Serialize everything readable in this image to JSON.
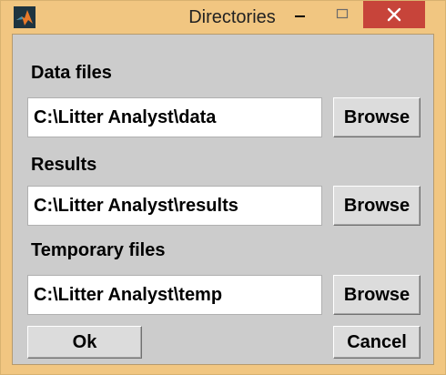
{
  "window": {
    "title": "Directories",
    "app_icon": "matlab-icon",
    "colors": {
      "frame": "#f1c681",
      "client": "#cccccc",
      "close": "#c7443a"
    }
  },
  "sections": [
    {
      "label": "Data files",
      "path": "C:\\Litter Analyst\\data",
      "button": "Browse"
    },
    {
      "label": "Results",
      "path": "C:\\Litter Analyst\\results",
      "button": "Browse"
    },
    {
      "label": "Temporary files",
      "path": "C:\\Litter Analyst\\temp",
      "button": "Browse"
    }
  ],
  "actions": {
    "ok": "Ok",
    "cancel": "Cancel"
  }
}
